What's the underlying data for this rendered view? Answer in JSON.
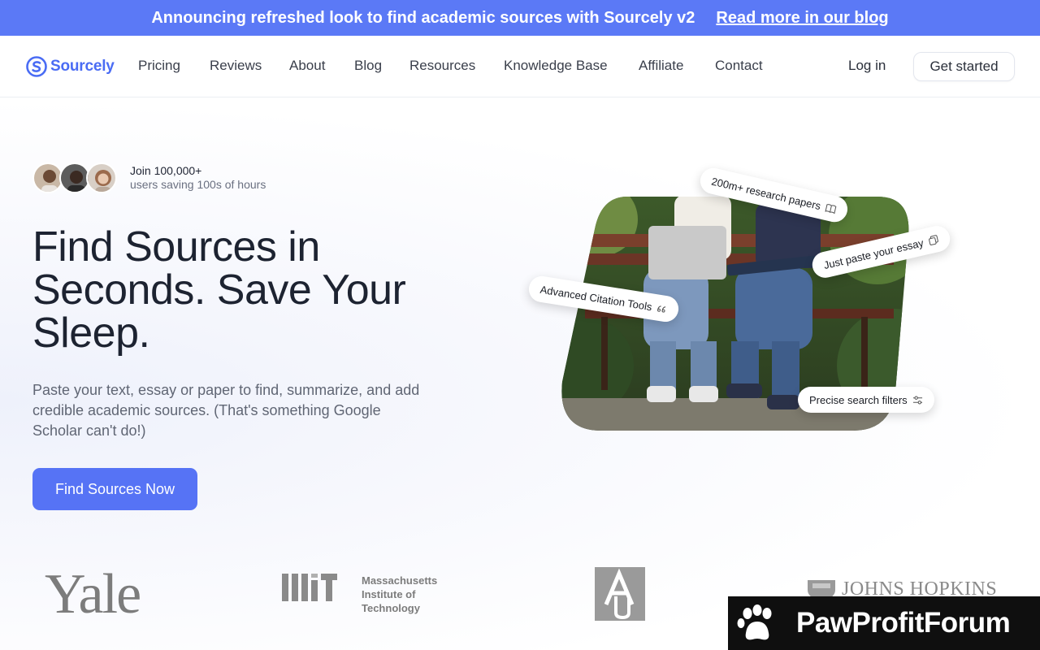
{
  "announcement": {
    "message": "Announcing refreshed look to find academic sources with Sourcely v2",
    "link": "Read more in our blog"
  },
  "header": {
    "brand": "Sourcely",
    "nav": [
      {
        "label": "Pricing"
      },
      {
        "label": "Reviews"
      },
      {
        "label": "About"
      },
      {
        "label": "Blog"
      },
      {
        "label": "Resources"
      },
      {
        "label": "Knowledge Base"
      },
      {
        "label": "Affiliate"
      },
      {
        "label": "Contact"
      }
    ],
    "login": "Log in",
    "get_started": "Get started"
  },
  "hero": {
    "social_proof": {
      "line1": "Join 100,000+",
      "line2": "users saving 100s of hours"
    },
    "headline": "Find Sources in Seconds. Save Your Sleep.",
    "subtext": "Paste your text, essay or paper to find, summarize, and add credible academic sources. (That's something Google Scholar can't do!)",
    "cta": "Find Sources Now",
    "chips": {
      "research_papers": "200m+ research papers",
      "paste_essay": "Just paste your essay",
      "citation_tools": "Advanced Citation Tools",
      "search_filters": "Precise search filters"
    }
  },
  "logos": {
    "yale": "Yale",
    "mit_lines": [
      "Massachusetts",
      "Institute of",
      "Technology"
    ],
    "johns_hopkins": "JOHNS HOPKINS"
  },
  "watermark": {
    "text": "PawProfitForum"
  },
  "colors": {
    "accent": "#5673f5",
    "announce_bg": "#5b79f6",
    "brand": "#4a6cf4",
    "logo_gray": "#7c7c7c",
    "watermark_bg": "#0f0f0f"
  },
  "icons": {
    "brand": "sourcely-s-icon",
    "research_papers": "book-open-icon",
    "paste_essay": "copy-icon",
    "citation_tools": "quote-icon",
    "search_filters": "sliders-icon",
    "watermark": "paw-icon"
  }
}
